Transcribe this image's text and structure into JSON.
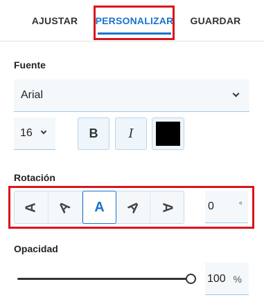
{
  "tabs": [
    {
      "label": "AJUSTAR",
      "active": false
    },
    {
      "label": "PERSONALIZAR",
      "active": true
    },
    {
      "label": "GUARDAR",
      "active": false
    }
  ],
  "font": {
    "section_label": "Fuente",
    "family_value": "Arial",
    "size_value": "16",
    "bold_label": "B",
    "italic_label": "I",
    "color": "#000000"
  },
  "rotation": {
    "section_label": "Rotación",
    "options": [
      {
        "glyph": "A",
        "angle": -90,
        "active": false
      },
      {
        "glyph": "A",
        "angle": -45,
        "active": false
      },
      {
        "glyph": "A",
        "angle": 0,
        "active": true
      },
      {
        "glyph": "A",
        "angle": 45,
        "active": false
      },
      {
        "glyph": "A",
        "angle": 90,
        "active": false
      }
    ],
    "value": "0",
    "unit": "°"
  },
  "opacity": {
    "section_label": "Opacidad",
    "value": "100",
    "unit": "%",
    "level": 1.0
  },
  "colors": {
    "accent": "#1a73c9",
    "highlight_box": "#d9141c"
  }
}
